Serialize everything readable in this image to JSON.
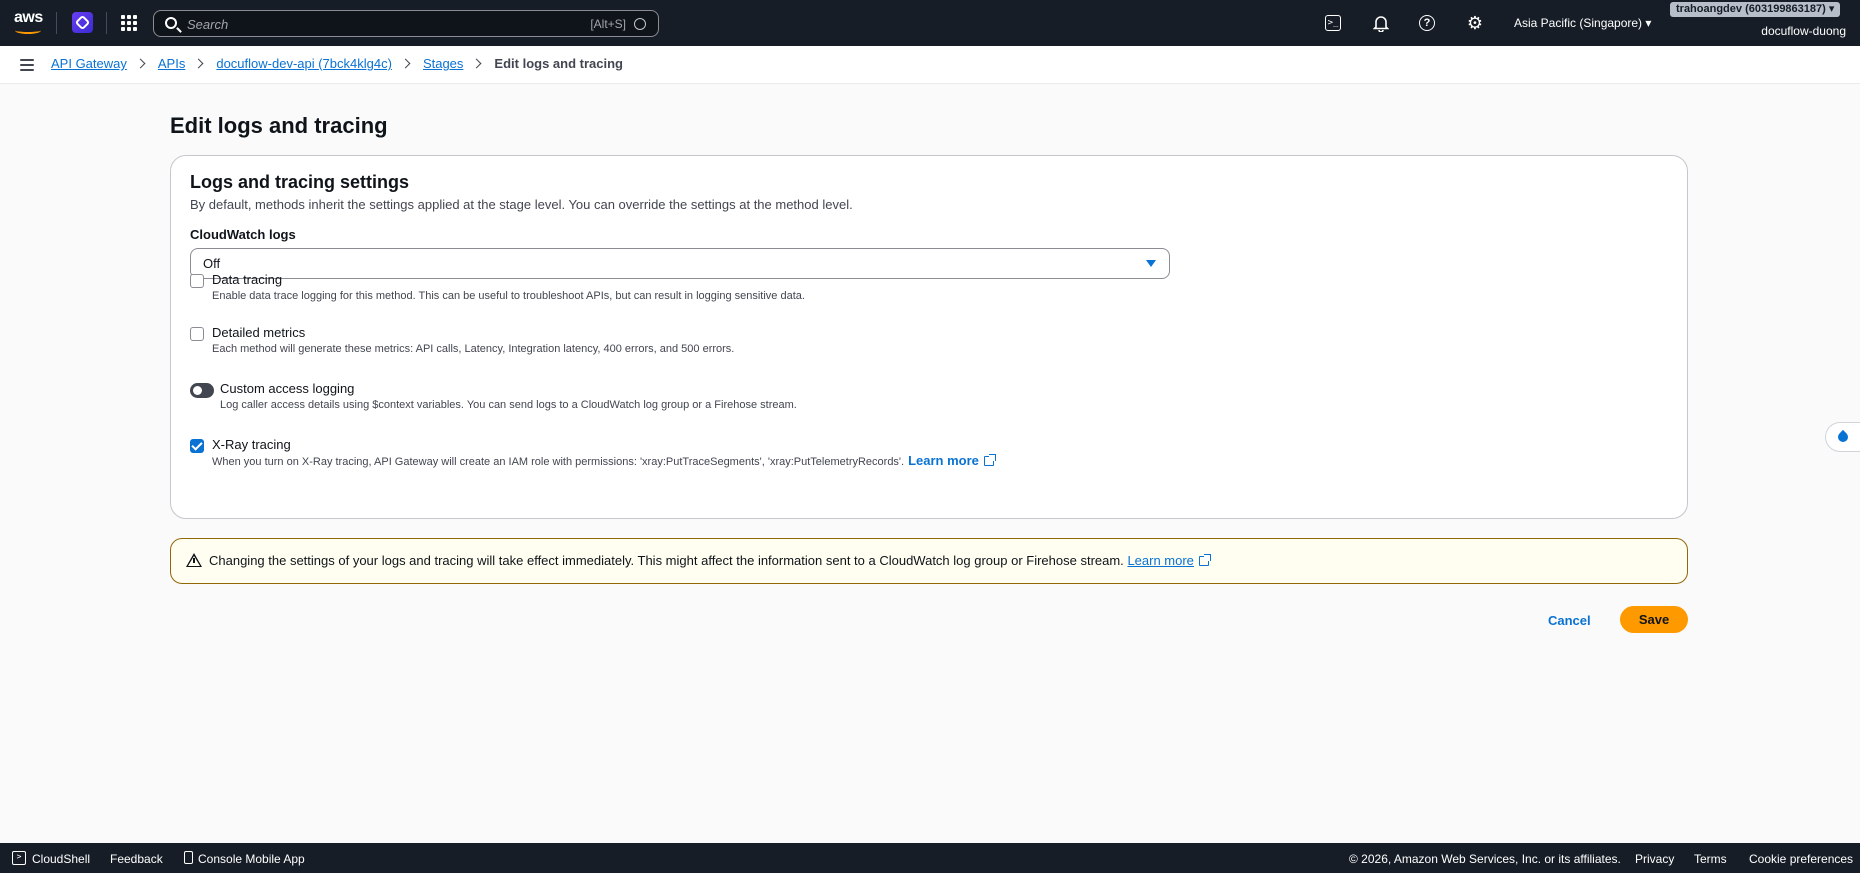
{
  "topnav": {
    "logo_text": "aws",
    "search_placeholder": "Search",
    "search_shortcut": "[Alt+S]",
    "region": "Asia Pacific (Singapore) ▾",
    "account_badge": "trahoangdev (603199863187) ▾",
    "account_user": "docuflow-duong"
  },
  "breadcrumb": {
    "items": [
      "API Gateway",
      "APIs",
      "docuflow-dev-api (7bck4klg4c)",
      "Stages"
    ],
    "current": "Edit logs and tracing"
  },
  "page": {
    "title": "Edit logs and tracing"
  },
  "settings": {
    "title": "Logs and tracing settings",
    "description": "By default, methods inherit the settings applied at the stage level. You can override the settings at the method level.",
    "cloudwatch_label": "CloudWatch logs",
    "cloudwatch_value": "Off",
    "data_tracing": {
      "label": "Data tracing",
      "description": "Enable data trace logging for this method. This can be useful to troubleshoot APIs, but can result in logging sensitive data.",
      "checked": false
    },
    "detailed_metrics": {
      "label": "Detailed metrics",
      "description": "Each method will generate these metrics: API calls, Latency, Integration latency, 400 errors, and 500 errors.",
      "checked": false
    },
    "custom_access_logging": {
      "label": "Custom access logging",
      "description": "Log caller access details using $context variables. You can send logs to a CloudWatch log group or a Firehose stream.",
      "enabled": false
    },
    "xray_tracing": {
      "label": "X-Ray tracing",
      "description": "When you turn on X-Ray tracing, API Gateway will create an IAM role with permissions: 'xray:PutTraceSegments', 'xray:PutTelemetryRecords'.",
      "learn_more": "Learn more",
      "checked": true
    }
  },
  "alert": {
    "text": "Changing the settings of your logs and tracing will take effect immediately. This might affect the information sent to a CloudWatch log group or Firehose stream.",
    "learn_more": "Learn more"
  },
  "actions": {
    "cancel": "Cancel",
    "save": "Save"
  },
  "footer": {
    "cloudshell": "CloudShell",
    "feedback": "Feedback",
    "mobile_app": "Console Mobile App",
    "copyright": "© 2026, Amazon Web Services, Inc. or its affiliates.",
    "privacy": "Privacy",
    "terms": "Terms",
    "cookies": "Cookie preferences"
  },
  "colors": {
    "nav_bg": "#161d26",
    "link": "#0972d3",
    "primary_button": "#ff9900",
    "warning_border": "#906806"
  }
}
